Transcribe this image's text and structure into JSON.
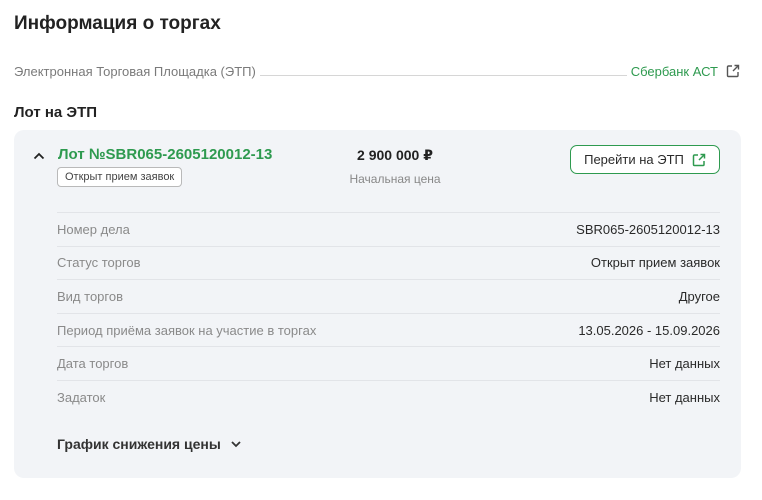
{
  "header": {
    "title": "Информация о торгах"
  },
  "etp": {
    "label": "Электронная Торговая Площадка (ЭТП)",
    "platform": "Сбербанк АСТ"
  },
  "lot_section": {
    "title": "Лот на ЭТП"
  },
  "lot": {
    "title": "Лот №SBR065-2605120012-13",
    "status_badge": "Открыт прием заявок",
    "price": "2 900 000 ₽",
    "price_caption": "Начальная цена",
    "go_button": "Перейти на ЭТП",
    "details": [
      {
        "label": "Номер дела",
        "value": "SBR065-2605120012-13"
      },
      {
        "label": "Статус торгов",
        "value": "Открыт прием заявок"
      },
      {
        "label": "Вид торгов",
        "value": "Другое"
      },
      {
        "label": "Период приёма заявок на участие в торгах",
        "value": "13.05.2026 - 15.09.2026"
      },
      {
        "label": "Дата торгов",
        "value": "Нет данных"
      },
      {
        "label": "Задаток",
        "value": "Нет данных"
      }
    ],
    "schedule_label": "График снижения цены"
  },
  "colors": {
    "accent": "#2e9a4f",
    "card_bg": "#f2f4f7"
  },
  "icons": {
    "collapse": "chevron-up-icon",
    "external": "external-link-icon",
    "expand": "chevron-down-icon"
  }
}
